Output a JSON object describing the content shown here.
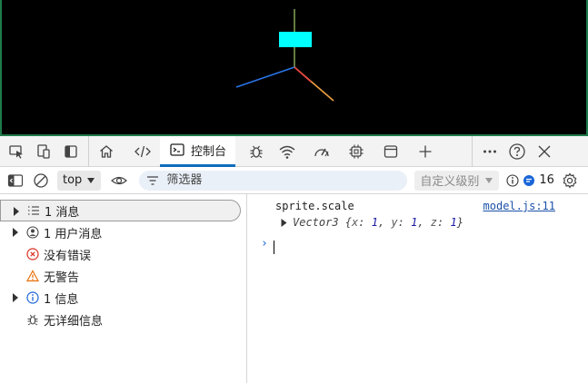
{
  "viewport": {
    "background": "#000000",
    "box_color": "#00ffff"
  },
  "toolbar": {
    "tabs": [
      {
        "id": "console",
        "label": "控制台",
        "active": true
      }
    ],
    "icons": [
      "inspect-icon",
      "device-emulation-icon",
      "dock-icon",
      "home-icon",
      "elements-icon",
      "console-icon",
      "bug-icon",
      "network-wifi-icon",
      "performance-gauge-icon",
      "cpu-icon",
      "application-window-icon",
      "add-icon",
      "more-icon",
      "help-icon",
      "close-icon"
    ]
  },
  "console_toolbar": {
    "context": "top",
    "filter_placeholder": "筛选器",
    "levels_label": "自定义级别",
    "issues_count": "16"
  },
  "sidebar": {
    "items": [
      {
        "label": "1 消息",
        "icon": "list-icon",
        "expandable": true,
        "selected": true
      },
      {
        "label": "1 用户消息",
        "icon": "user-icon",
        "expandable": true,
        "selected": false
      },
      {
        "label": "没有错误",
        "icon": "error-icon",
        "expandable": false,
        "selected": false
      },
      {
        "label": "无警告",
        "icon": "warning-icon",
        "expandable": false,
        "selected": false
      },
      {
        "label": "1 信息",
        "icon": "info-icon",
        "expandable": true,
        "selected": false
      },
      {
        "label": "无详细信息",
        "icon": "verbose-bug-icon",
        "expandable": false,
        "selected": false
      }
    ]
  },
  "output": {
    "log_text": "sprite.scale",
    "source": "model.js:11",
    "object": {
      "type": "Vector3",
      "x": "1",
      "y": "1",
      "z": "1"
    },
    "prompt_symbol": "›"
  },
  "colors": {
    "accent": "#0f6cbd",
    "toolbar_bg": "#f3f3f3",
    "link": "#1a50a8",
    "prompt": "#1a66d8",
    "viewport_border": "#1f7a4a"
  }
}
